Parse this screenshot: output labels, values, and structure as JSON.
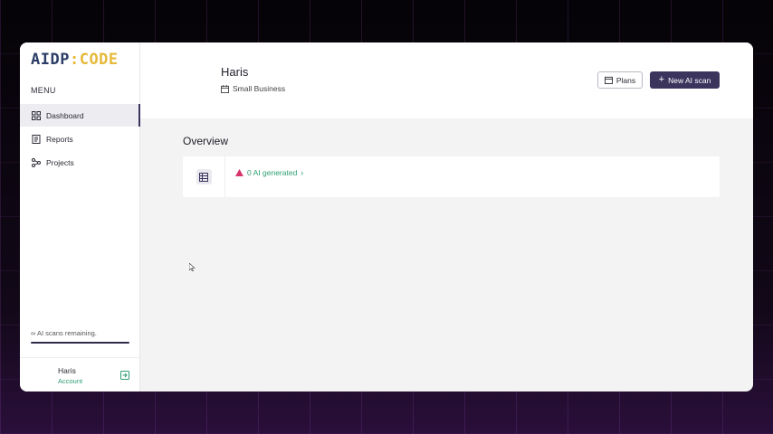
{
  "app": {
    "logo_primary": "AIDP",
    "logo_separator": ":",
    "logo_secondary": "CODE"
  },
  "sidebar": {
    "menu_label": "MENU",
    "items": [
      {
        "label": "Dashboard",
        "icon": "grid-icon",
        "active": true
      },
      {
        "label": "Reports",
        "icon": "document-icon",
        "active": false
      },
      {
        "label": "Projects",
        "icon": "share-nodes-icon",
        "active": false
      }
    ],
    "scans_remaining_text": "∞ AI scans remaining.",
    "scans_progress_fraction": 1.0
  },
  "user": {
    "name": "Haris",
    "account_label": "Account",
    "logout_icon": "logout-icon"
  },
  "header": {
    "name": "Haris",
    "plan": "Small Business",
    "plans_button": "Plans",
    "new_scan_button": "New AI scan"
  },
  "overview": {
    "title": "Overview",
    "card_link": "0 AI generated",
    "card_icon": "table-icon"
  },
  "colors": {
    "accent": "#3b355e",
    "success_text": "#2e9e72",
    "warning_icon": "#d6336c",
    "logo_primary": "#2c3e66",
    "logo_secondary": "#e6b93a"
  }
}
